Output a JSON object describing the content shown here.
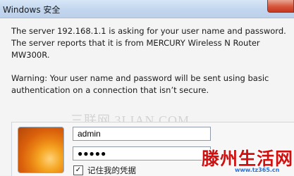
{
  "window": {
    "title": "Windows 安全"
  },
  "message": {
    "line1": "The server 192.168.1.1 is asking for your user name and password. The server reports that it is from MERCURY Wireless N Router MW300R.",
    "warning": "Warning: Your user name and password will be sent using basic authentication on a connection that isn’t secure."
  },
  "credentials": {
    "username": "admin",
    "password_masked": "●●●●●",
    "remember_label": "记住我的凭据",
    "remember_checked": "✓"
  },
  "watermark": "三联网 3LIAN.COM",
  "logo": {
    "text": "滕州生活网",
    "url": "www.tz365.cn"
  }
}
